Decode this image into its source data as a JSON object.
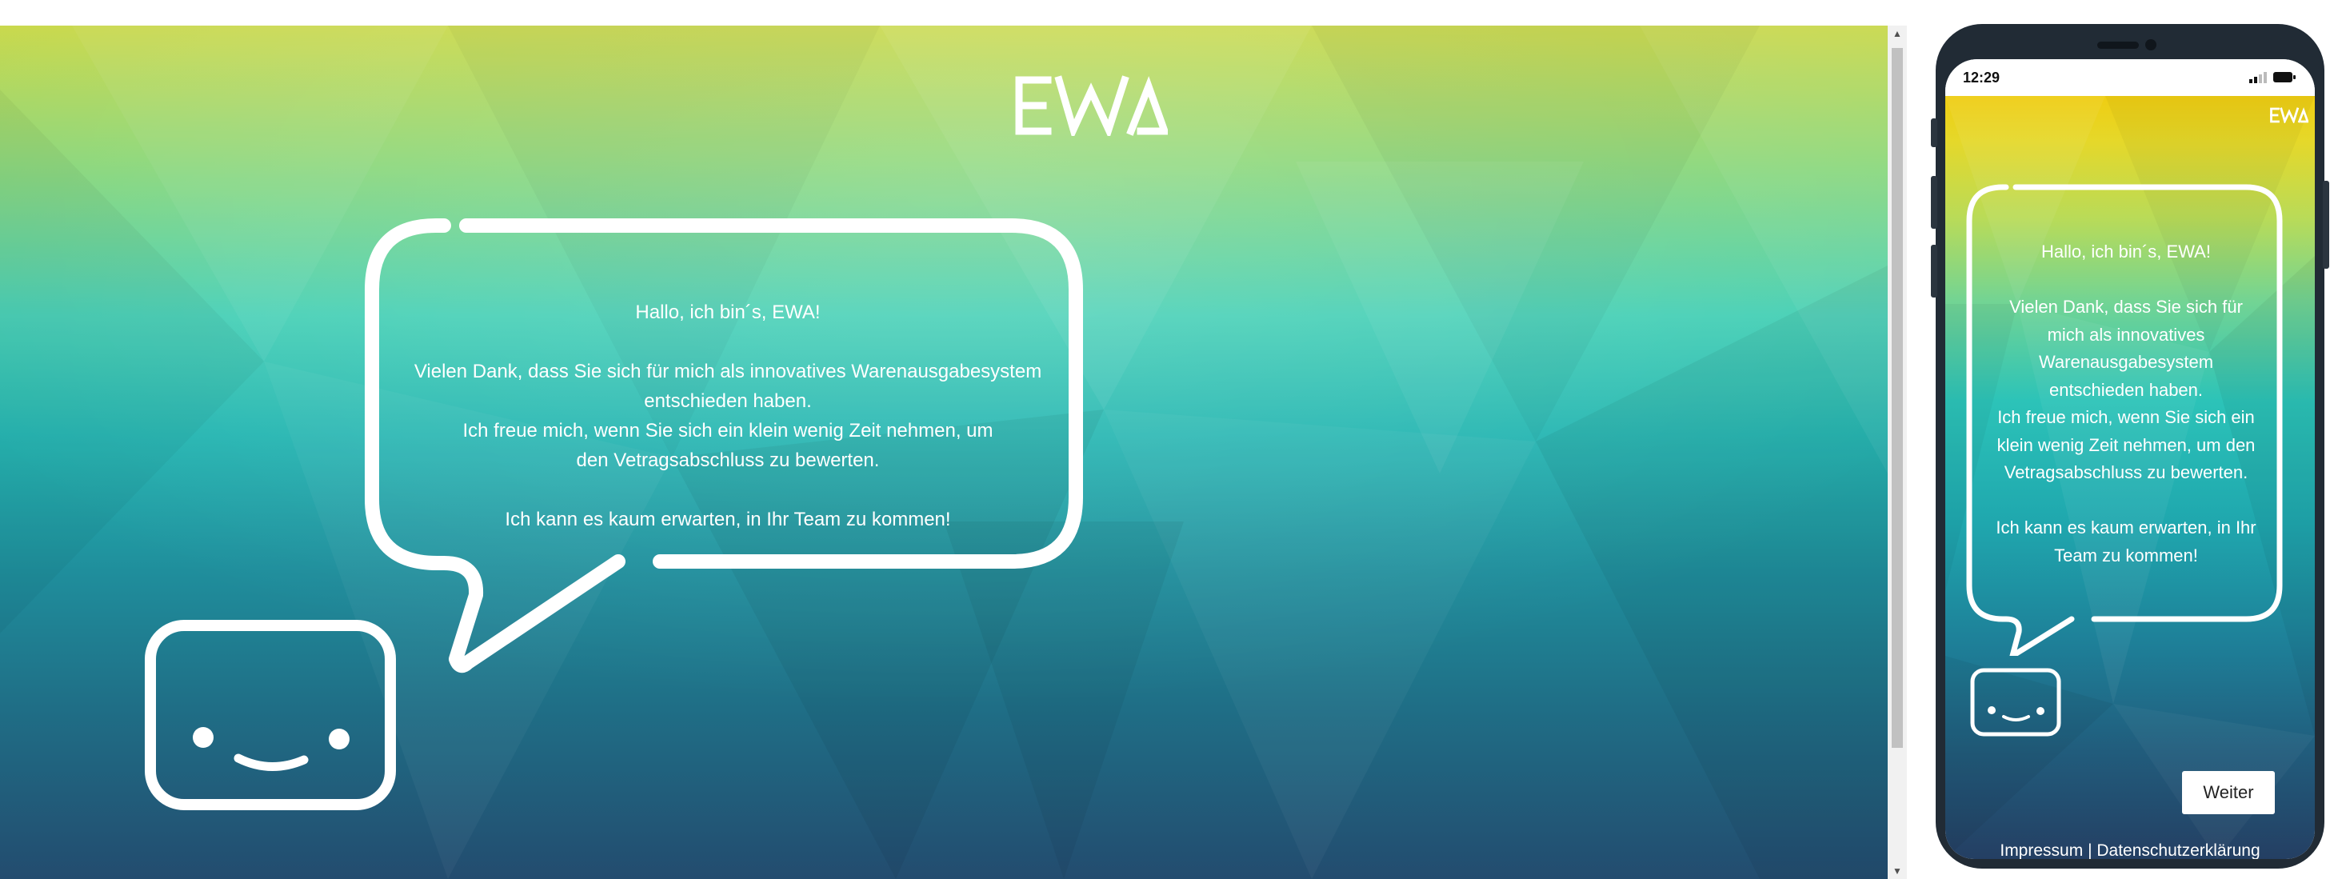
{
  "desktop": {
    "logo_text": "EWA",
    "bubble": {
      "greeting": "Hallo, ich bin´s, EWA!",
      "thanks": "Vielen Dank, dass Sie sich für mich als innovatives Warenausgabesystem entschieden haben.",
      "request": "Ich freue mich, wenn Sie sich ein klein wenig Zeit nehmen, um den Vetragsabschluss zu bewerten.",
      "closing": "Ich kann es kaum erwarten, in Ihr Team zu kommen!"
    },
    "scroll_up_arrow": "▲",
    "scroll_down_arrow": "▼"
  },
  "phone": {
    "status_time": "12:29",
    "logo_text": "EWA",
    "bubble": {
      "greeting": "Hallo, ich bin´s, EWA!",
      "thanks": "Vielen Dank, dass Sie sich für mich als innovatives Warenausgabesystem entschieden haben.",
      "request": "Ich freue mich, wenn Sie sich ein klein wenig Zeit nehmen, um den Vetragsabschluss zu bewerten.",
      "closing": "Ich kann es kaum erwarten, in Ihr Team zu kommen!"
    },
    "next_button_label": "Weiter",
    "footer": {
      "impressum_label": "Impressum",
      "separator": "|",
      "privacy_label": "Datenschutzerklärung"
    }
  },
  "colors": {
    "gradient_top": "#c9d84a",
    "gradient_mid": "#26b6b2",
    "gradient_bottom": "#234c6f",
    "phone_gradient_top": "#efcd12",
    "phone_frame": "#212b35",
    "stroke": "#ffffff"
  },
  "icons": [
    "ewa-logo-icon",
    "speech-bubble-icon",
    "smiley-robot-icon",
    "signal-icon",
    "battery-icon"
  ]
}
